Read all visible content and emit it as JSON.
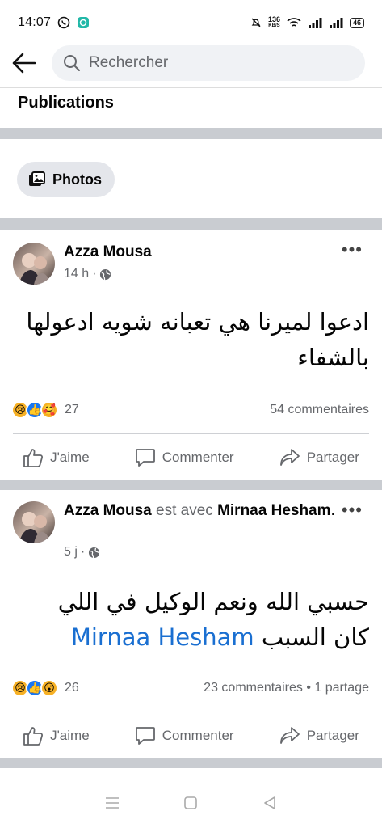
{
  "status_bar": {
    "time": "14:07",
    "speed_value": "136",
    "speed_unit": "KB/S",
    "battery": "46"
  },
  "search": {
    "placeholder": "Rechercher"
  },
  "section": {
    "title": "Publications"
  },
  "filters": {
    "photos_label": "Photos"
  },
  "posts": [
    {
      "author": "Azza Mousa",
      "time": "14 h",
      "text": "ادعوا لميرنا هي تعبانه شويه ادعولها بالشفاء",
      "reaction_count": "27",
      "stats": "54 commentaires",
      "reactions": [
        "sad",
        "like",
        "care"
      ]
    },
    {
      "author": "Azza Mousa",
      "with_word": "est avec",
      "tagged": "Mirnaa Hesham",
      "time": "5 j",
      "text": "حسبي الله ونعم الوكيل في اللي كان السبب",
      "mention": "Mirnaa Hesham",
      "reaction_count": "26",
      "stats": "23 commentaires • 1 partage",
      "reactions": [
        "sad",
        "like",
        "wow"
      ]
    }
  ],
  "actions": {
    "like": "J'aime",
    "comment": "Commenter",
    "share": "Partager"
  },
  "colors": {
    "link": "#1a6fd1",
    "like_blue": "#1877f2",
    "separator": "#c9ccd1"
  }
}
